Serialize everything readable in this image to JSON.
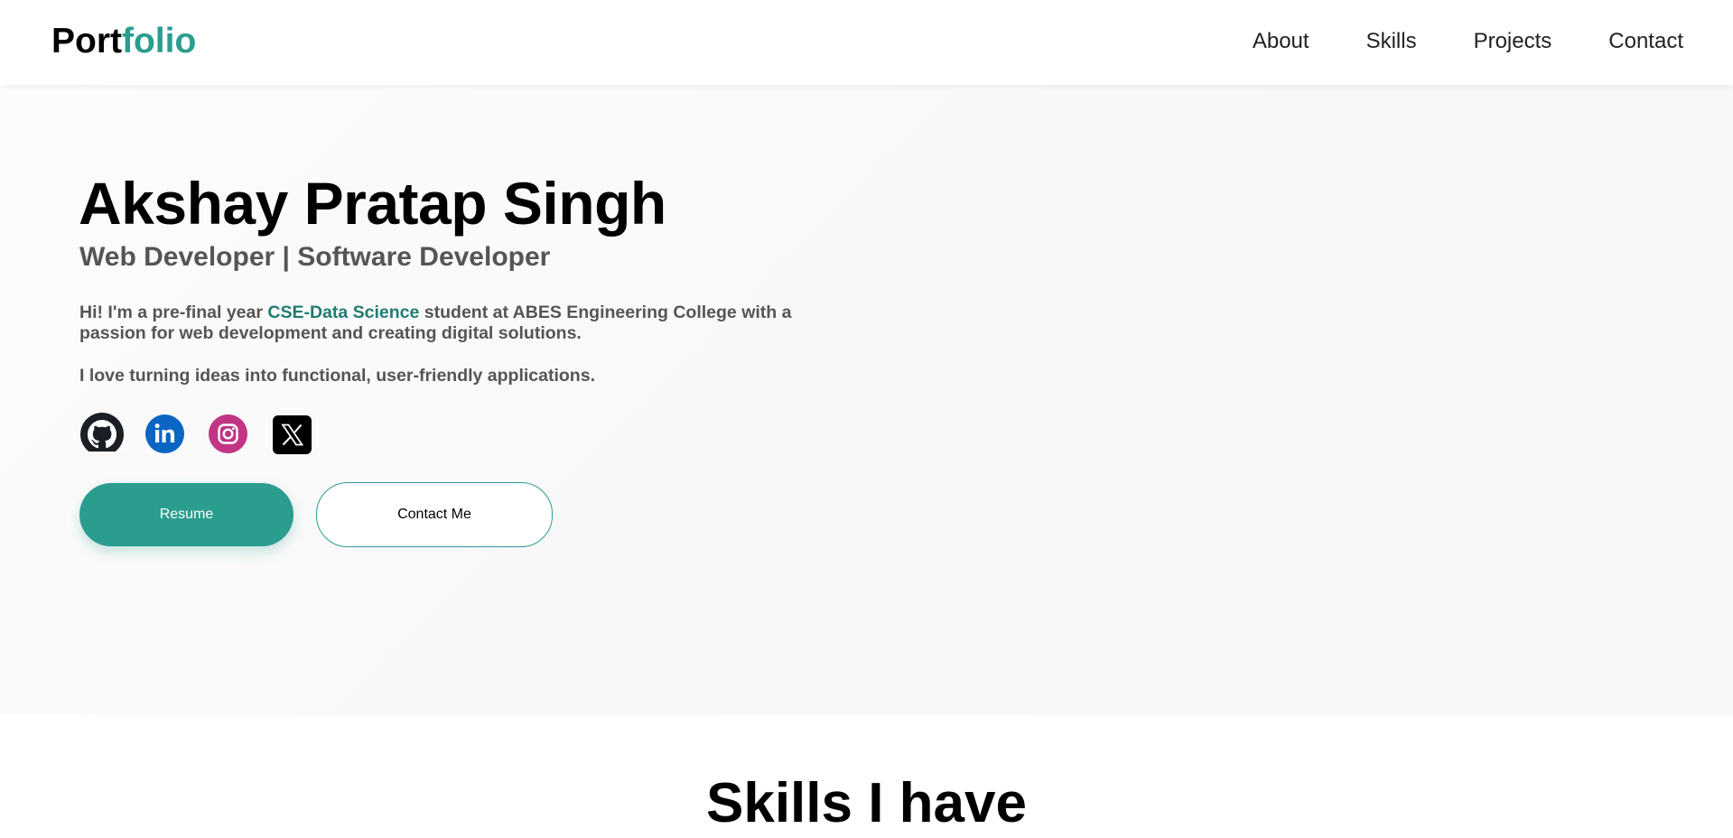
{
  "header": {
    "logo_part1": "Port",
    "logo_part2": "folio",
    "nav": [
      "About",
      "Skills",
      "Projects",
      "Contact"
    ]
  },
  "hero": {
    "name": "Akshay Pratap Singh",
    "role": "Web Developer | Software Developer",
    "intro_before": "Hi! I'm a pre-final year ",
    "intro_highlight": "CSE-Data Science",
    "intro_after": " student at ABES Engineering College with a passion for web development and creating digital solutions.",
    "love": "I love turning ideas into functional, user-friendly applications.",
    "social_icons": [
      "github-icon",
      "linkedin-icon",
      "instagram-icon",
      "x-twitter-icon"
    ],
    "buttons": {
      "resume": "Resume",
      "contact": "Contact Me"
    }
  },
  "skills": {
    "title": "Skills I have"
  },
  "colors": {
    "accent": "#2a9d8f",
    "highlight": "#1f7d72",
    "text_muted": "#555555",
    "linkedin": "#0a66c2",
    "instagram": "#c13584"
  }
}
